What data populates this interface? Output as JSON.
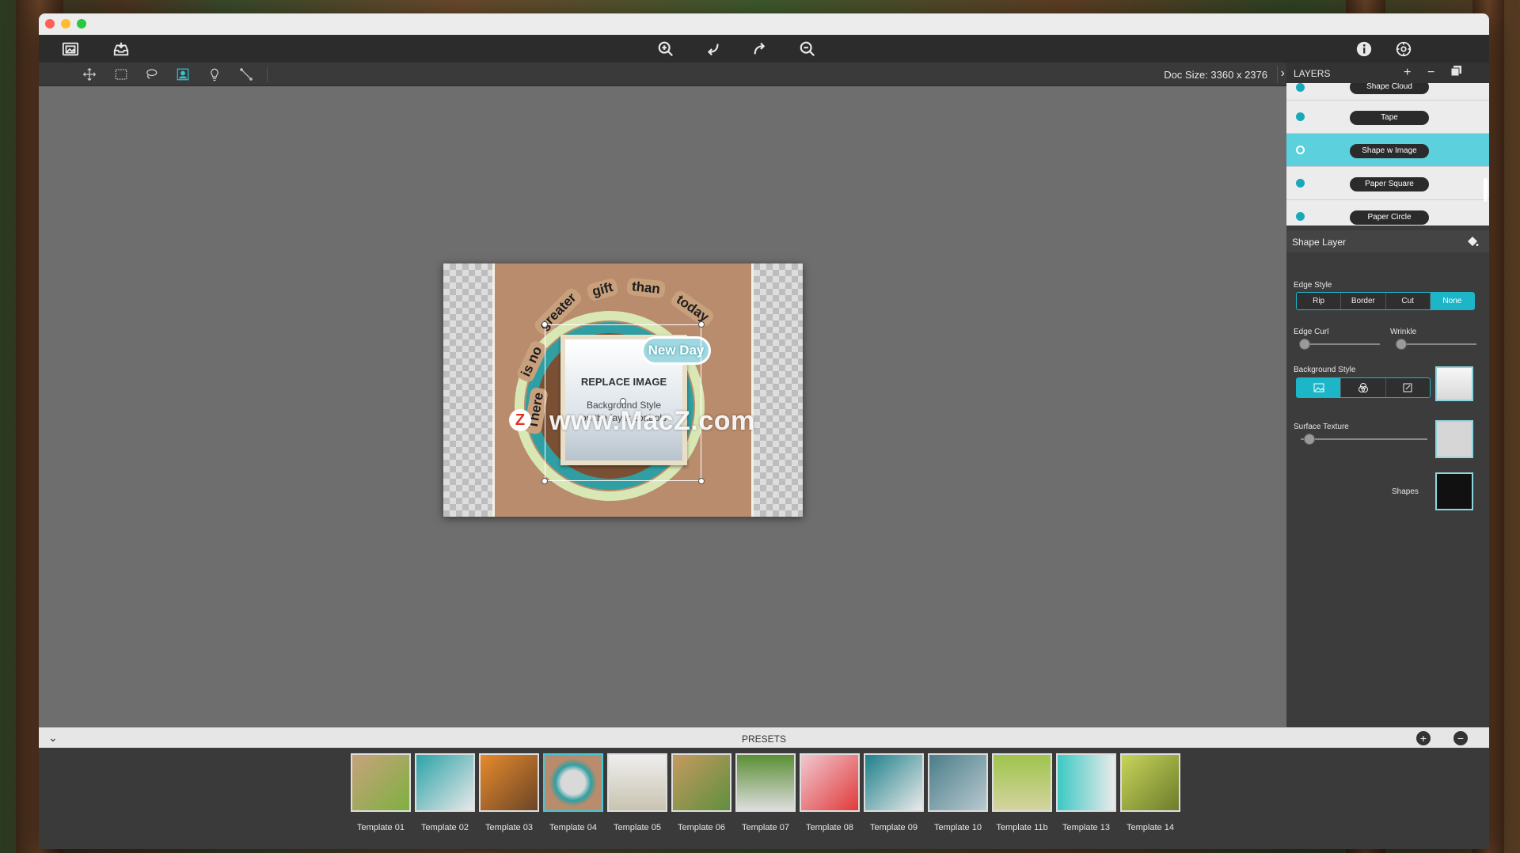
{
  "toolbar": {
    "left_buttons": [
      "photo-library-icon",
      "import-tray-icon"
    ],
    "center_buttons": [
      "zoom-in-icon",
      "undo-icon",
      "redo-icon",
      "zoom-out-icon"
    ],
    "right_buttons": [
      "info-icon",
      "settings-gear-icon"
    ]
  },
  "tools": [
    "move-tool",
    "rect-select-tool",
    "lasso-tool",
    "person-select-tool",
    "bulb-tool",
    "line-tool"
  ],
  "active_tool": "person-select-tool",
  "doc_size_label": "Doc Size: 3360 x 2376",
  "canvas": {
    "replace_title": "REPLACE IMAGE",
    "replace_line1": "Background Style",
    "replace_line2": "on the layer controls",
    "cloud_text": "New Day",
    "words": [
      "There",
      "is no",
      "greater",
      "gift",
      "than",
      "today"
    ],
    "watermark": "www.MacZ.com",
    "watermark_badge": "Z"
  },
  "layers": {
    "title": "LAYERS",
    "add": "+",
    "remove": "−",
    "items": [
      {
        "label": "Shape Cloud",
        "selected": false
      },
      {
        "label": "Tape",
        "selected": false
      },
      {
        "label": "Shape w Image",
        "selected": true
      },
      {
        "label": "Paper Square",
        "selected": false
      },
      {
        "label": "Paper Circle",
        "selected": false
      }
    ]
  },
  "shape_layer": {
    "title": "Shape Layer",
    "edge_style_label": "Edge Style",
    "edge_styles": [
      "Rip",
      "Border",
      "Cut",
      "None"
    ],
    "edge_style_selected": "None",
    "edge_curl_label": "Edge Curl",
    "edge_curl_value": 0,
    "wrinkle_label": "Wrinkle",
    "wrinkle_value": 0,
    "background_style_label": "Background Style",
    "surface_texture_label": "Surface Texture",
    "surface_texture_value": 0.05,
    "shapes_label": "Shapes"
  },
  "presets": {
    "title": "PRESETS",
    "items": [
      "Template 01",
      "Template 02",
      "Template 03",
      "Template 04",
      "Template 05",
      "Template 06",
      "Template 07",
      "Template 08",
      "Template 09",
      "Template 10",
      "Template 11b",
      "Template 13",
      "Template 14"
    ],
    "selected": "Template 04"
  },
  "colors": {
    "accent": "#1db6c8",
    "panel": "#3c3c3c",
    "canvas": "#6e6e6e"
  }
}
